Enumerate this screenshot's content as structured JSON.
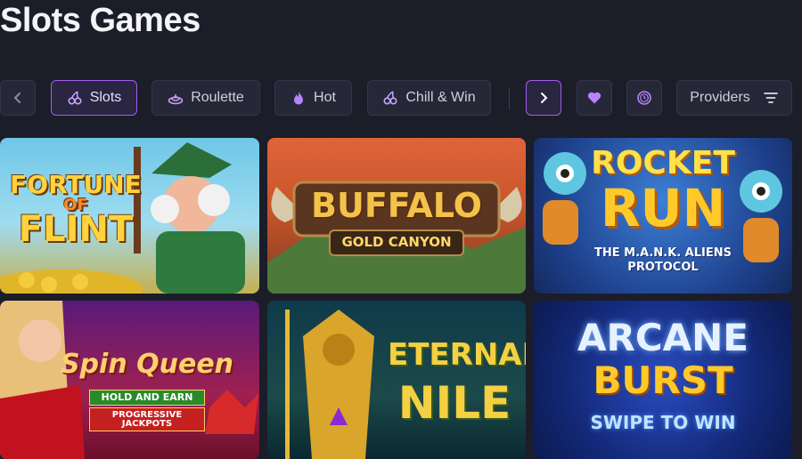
{
  "page": {
    "title": "Slots Games"
  },
  "filters": {
    "prev_label": "‹",
    "next_label": "›",
    "items": [
      {
        "label": "Slots",
        "icon": "cherry-icon",
        "active": true
      },
      {
        "label": "Roulette",
        "icon": "roulette-icon",
        "active": false
      },
      {
        "label": "Hot",
        "icon": "flame-icon",
        "active": false
      },
      {
        "label": "Chill & Win",
        "icon": "cherry-icon",
        "active": false
      }
    ],
    "favorites_icon": "heart-icon",
    "recent_icon": "clock-icon",
    "providers_label": "Providers",
    "providers_icon": "filter-icon"
  },
  "games": [
    {
      "line1": "FORTUNE",
      "line2": "OF",
      "line3": "FLINT"
    },
    {
      "line1": "BUFFALO",
      "line2": "GOLD CANYON",
      "line3": ""
    },
    {
      "line1": "ROCKET",
      "line2": "RUN",
      "line3": "THE M.A.N.K. ALIENS PROTOCOL"
    },
    {
      "line1": "Spin Queen",
      "line2": "HOLD AND EARN",
      "line3": "PROGRESSIVE JACKPOTS"
    },
    {
      "line1": "ETERNAL",
      "line2": "NILE",
      "line3": ""
    },
    {
      "line1": "ARCANE",
      "line2": "BURST",
      "line3": "SWIPE TO WIN"
    }
  ],
  "colors": {
    "background": "#1b1d29",
    "chip": "#262837",
    "accent": "#a05ef0"
  }
}
